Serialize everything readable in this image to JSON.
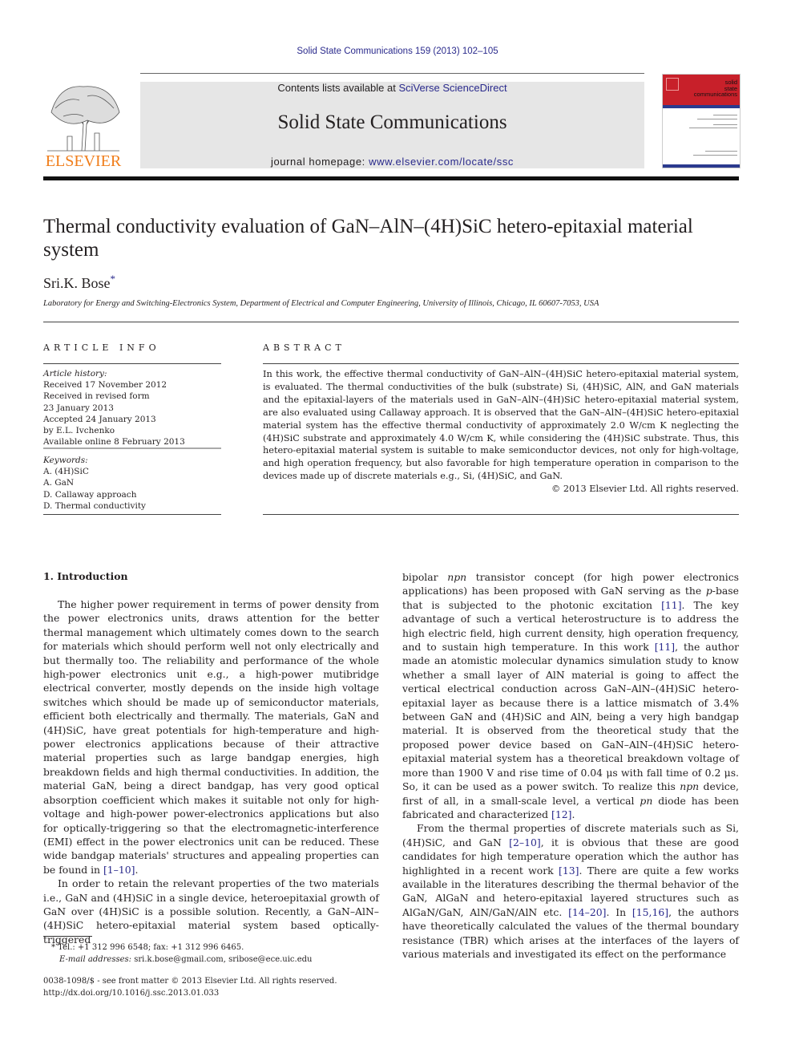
{
  "header": {
    "running_citation": "Solid State Communications 159 (2013) 102–105",
    "contents_prefix": "Contents lists available at ",
    "contents_link": "SciVerse ScienceDirect",
    "journal_title": "Solid State Communications",
    "homepage_prefix": "journal homepage: ",
    "homepage_link": "www.elsevier.com/locate/ssc",
    "publisher_logo": "ELSEVIER",
    "cover": {
      "line1": "solid",
      "line2": "state",
      "line3": "communications"
    }
  },
  "article": {
    "title": "Thermal conductivity evaluation of GaN–AlN–(4H)SiC hetero-epitaxial material system",
    "author": "Sri.K. Bose",
    "author_mark": "*",
    "affiliation": "Laboratory for Energy and Switching-Electronics System, Department of Electrical and Computer Engineering, University of Illinois, Chicago, IL 60607-7053, USA"
  },
  "article_info": {
    "heading": "ARTICLE INFO",
    "history_label": "Article history:",
    "history": [
      "Received 17 November 2012",
      "Received in revised form",
      "23 January 2013",
      "Accepted 24 January 2013",
      "by E.L. Ivchenko",
      "Available online 8 February 2013"
    ],
    "keywords_label": "Keywords:",
    "keywords": [
      "A. (4H)SiC",
      "A. GaN",
      "D. Callaway approach",
      "D. Thermal conductivity"
    ]
  },
  "abstract": {
    "heading": "ABSTRACT",
    "text": "In this work, the effective thermal conductivity of GaN–AlN–(4H)SiC hetero-epitaxial material system, is evaluated. The thermal conductivities of the bulk (substrate) Si, (4H)SiC, AlN, and GaN materials and the epitaxial-layers of the materials used in GaN–AlN–(4H)SiC hetero-epitaxial material system, are also evaluated using Callaway approach. It is observed that the GaN–AlN–(4H)SiC hetero-epitaxial material system has the effective thermal conductivity of approximately 2.0 W/cm K neglecting the (4H)SiC substrate and approximately 4.0 W/cm K, while considering the (4H)SiC substrate. Thus, this hetero-epitaxial material system is suitable to make semiconductor devices, not only for high-voltage, and high operation frequency, but also favorable for high temperature operation in comparison to the devices made up of discrete materials e.g., Si, (4H)SiC, and GaN.",
    "copyright": "© 2013 Elsevier Ltd. All rights reserved."
  },
  "intro": {
    "heading": "1.  Introduction",
    "p1": "The higher power requirement in terms of power density from the power electronics units, draws attention for the better thermal management which ultimately comes down to the search for materials which should perform well not only electrically and but thermally too. The reliability and performance of the whole high-power electronics unit e.g., a high-power mutibridge electrical converter, mostly depends on the inside high voltage switches which should be made up of semiconductor materials, efficient both electrically and thermally. The materials, GaN and (4H)SiC, have great potentials for high-temperature and high-power electronics applications because of their attractive material properties such as large bandgap energies, high breakdown fields and high thermal conductivities. In addition, the material GaN, being a direct bandgap, has very good optical absorption coefficient which makes it suitable not only for high-voltage and high-power power-electronics applications but also for optically-triggering so that the electromagnetic-interference (EMI) effect in the power electronics unit can be reduced. These wide bandgap materials' structures and appealing properties can be found in ",
    "p1_ref": "[1–10]",
    "p2": "In order to retain the relevant properties of the two materials i.e., GaN and (4H)SiC in a single device, heteroepitaxial growth of GaN over (4H)SiC is a possible solution. Recently, a GaN–AlN–(4H)SiC hetero-epitaxial material system based optically-triggered",
    "c2_a": "bipolar ",
    "c2_a_it": "npn",
    "c2_b": " transistor concept (for high power electronics applications) has been proposed with GaN serving as the ",
    "c2_b_it": "p",
    "c2_c": "-base that is subjected to the photonic excitation ",
    "ref11": "[11]",
    "c2_d": ". The key advantage of such a vertical heterostructure is to address the high electric field, high current density, high operation frequency, and to sustain high temperature. In this work ",
    "c2_e": ", the author made an atomistic molecular dynamics simulation study to know whether a small layer of AlN material is going to affect the vertical electrical conduction across GaN–AlN–(4H)SiC hetero-epitaxial layer as because there is a lattice mismatch of 3.4% between GaN and (4H)SiC and AlN, being a very high bandgap material. It is observed from the theoretical study that the proposed power device based on GaN–AlN–(4H)SiC hetero-epitaxial material system has a theoretical breakdown voltage of more than 1900 V and rise time of 0.04 μs with fall time of 0.2 μs. So, it can be used as a power switch. To realize this ",
    "c2_e_it": "npn",
    "c2_f": " device, first of all, in a small-scale level, a vertical ",
    "c2_f_it": "pn",
    "c2_g": " diode has been fabricated and characterized ",
    "ref12": "[12]",
    "c2_p2a": "From the thermal properties of discrete materials such as Si, (4H)SiC, and GaN ",
    "ref2_10": "[2–10]",
    "c2_p2b": ", it is obvious that these are good candidates for high temperature operation which the author has highlighted in a recent work ",
    "ref13": "[13]",
    "c2_p2c": ". There are quite a few works available in the literatures describing the thermal behavior of the GaN, AlGaN and hetero-epitaxial layered structures such as AlGaN/GaN, AlN/GaN/AlN etc. ",
    "ref14_20": "[14–20]",
    "c2_p2d": ". In ",
    "ref15_16": "[15,16]",
    "c2_p2e": ", the authors have theoretically calculated the values of the thermal boundary resistance (TBR) which arises at the interfaces of the layers of various materials and investigated its effect on the performance"
  },
  "footnote": {
    "tel": "* Tel.: +1 312 996 6548; fax: +1 312 996 6465.",
    "email_label": "E-mail addresses: ",
    "emails": "sri.k.bose@gmail.com, sribose@ece.uic.edu"
  },
  "bottom": {
    "issn": "0038-1098/$ - see front matter © 2013 Elsevier Ltd. All rights reserved.",
    "doi": "http://dx.doi.org/10.1016/j.ssc.2013.01.033"
  }
}
